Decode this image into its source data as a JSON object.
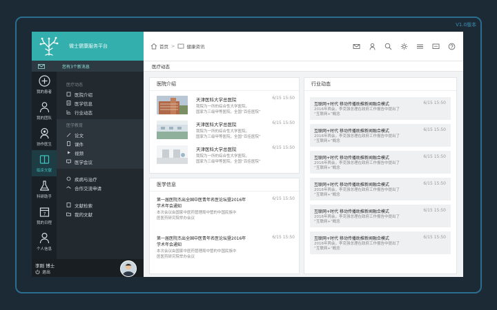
{
  "version": "V1.0版本",
  "sidebar": {
    "platform_name": "微士健康服务平台",
    "message_notice": "您有3个新消息",
    "rail": [
      {
        "label": "我的患者",
        "icon": "plus-circle-icon"
      },
      {
        "label": "我的团队",
        "icon": "team-icon"
      },
      {
        "label": "协作医生",
        "icon": "doctor-icon"
      },
      {
        "label": "临床文献",
        "icon": "book-icon"
      },
      {
        "label": "科研助手",
        "icon": "flask-icon"
      },
      {
        "label": "我的日程",
        "icon": "calendar-icon"
      },
      {
        "label": "个人信息",
        "icon": "person-icon"
      }
    ],
    "submenu": [
      {
        "title": "医疗动态",
        "items": [
          "医院介绍",
          "医学信息",
          "行业动态"
        ]
      },
      {
        "title": "医学教育",
        "items": [
          "论文",
          "课件",
          "视频",
          "医学会议"
        ]
      },
      {
        "title": "",
        "items": [
          "疾病与治疗",
          "合作交流申请"
        ]
      },
      {
        "title": "",
        "items": [
          "文献检索",
          "我的文献"
        ]
      }
    ],
    "user": {
      "name": "李刚 博士",
      "logout": "退出"
    }
  },
  "topbar": {
    "home": "首页",
    "current": "健康资讯"
  },
  "page_title": "医疗动态",
  "hospital_intro": {
    "title": "医院介绍",
    "items": [
      {
        "name": "天津医科大学总医院",
        "desc1": "我院为一所的综合性大学医院，",
        "desc2": "国家为三级甲等医院，全国“百佳医院”",
        "date": "6/15 15:50"
      },
      {
        "name": "天津医科大学总医院",
        "desc1": "我院为一所的综合性大学医院，",
        "desc2": "国家为三级甲等医院，全国“百佳医院”",
        "date": "6/15 15:50"
      },
      {
        "name": "天津医科大学总医院",
        "desc1": "我院为一所的综合性大学医院，",
        "desc2": "国家为三级甲等医院，全国“百佳医院”",
        "date": "6/15 15:50"
      }
    ]
  },
  "medical_info": {
    "title": "医学信息",
    "items": [
      {
        "title1": "第一届医院杰出全国中医青年名医论坛暨2016年",
        "title2": "学术年会通知",
        "desc1": "本次会议由国家中医药管理局中管的中国民族中",
        "desc2": "医医药研究院举办会议",
        "date": "6/15 15:50"
      },
      {
        "title1": "第一届医院杰出全国中医青年名医论坛暨2016年",
        "title2": "学术年会通知",
        "desc1": "本次会议由国家中医药管理局中管的中国民族中",
        "desc2": "医医药研究院举办会议",
        "date": "6/15 15:50"
      }
    ]
  },
  "industry": {
    "title": "行业动态",
    "items": [
      {
        "title": "互联网+时代 移动传播助推新闻融合模式",
        "desc1": "2016年两会，李克强总理在政府工作报告中提出了",
        "desc2": "“互联网+”概念",
        "date": "6/15 15:50"
      },
      {
        "title": "互联网+时代 移动传播助推新闻融合模式",
        "desc1": "2016年两会，李克强总理在政府工作报告中提出了",
        "desc2": "“互联网+”概念",
        "date": "6/15 15:50"
      },
      {
        "title": "互联网+时代 移动传播助推新闻融合模式",
        "desc1": "2016年两会，李克强总理在政府工作报告中提出了",
        "desc2": "“互联网+”概念",
        "date": "6/15 15:50"
      },
      {
        "title": "互联网+时代 移动传播助推新闻融合模式",
        "desc1": "2016年两会，李克强总理在政府工作报告中提出了",
        "desc2": "“互联网+”概念",
        "date": "6/15 15:50"
      },
      {
        "title": "互联网+时代 移动传播助推新闻融合模式",
        "desc1": "2016年两会，李克强总理在政府工作报告中提出了",
        "desc2": "“互联网+”概念",
        "date": "6/15 15:50"
      },
      {
        "title": "互联网+时代 移动传播助推新闻融合模式",
        "desc1": "2016年两会，李克强总理在政府工作报告中提出了",
        "desc2": "“互联网+”概念",
        "date": "6/15 15:50"
      }
    ]
  },
  "colors": {
    "accent": "#33b0ad",
    "sidebar": "#222a2f",
    "bezel": "#2a6e92"
  }
}
